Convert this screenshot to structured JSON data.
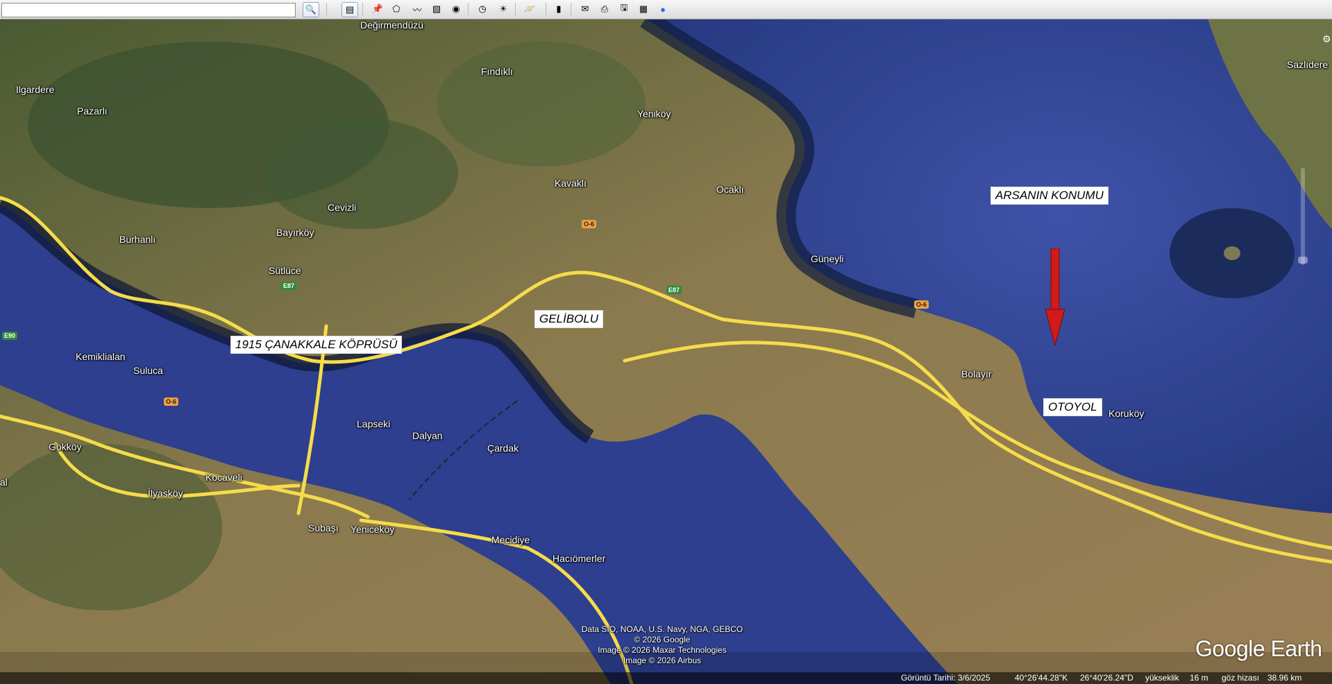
{
  "toolbar": {
    "search_value": "",
    "buttons": [
      {
        "name": "search-button",
        "icon": "magnifier-icon",
        "glyph": "🔍"
      },
      {
        "name": "sidebar-toggle-button",
        "icon": "sidebar-icon",
        "glyph": "▤"
      },
      {
        "name": "add-placemark-button",
        "icon": "pushpin-icon",
        "glyph": "📌"
      },
      {
        "name": "add-polygon-button",
        "icon": "polygon-icon",
        "glyph": "⬠"
      },
      {
        "name": "add-path-button",
        "icon": "path-icon",
        "glyph": "〰"
      },
      {
        "name": "image-overlay-button",
        "icon": "overlay-icon",
        "glyph": "▧"
      },
      {
        "name": "record-tour-button",
        "icon": "tour-icon",
        "glyph": "◉"
      },
      {
        "name": "historical-imagery-button",
        "icon": "clock-icon",
        "glyph": "◷"
      },
      {
        "name": "sunlight-button",
        "icon": "sun-icon",
        "glyph": "☀"
      },
      {
        "name": "planets-button",
        "icon": "planet-icon",
        "glyph": "🪐"
      },
      {
        "name": "ruler-button",
        "icon": "ruler-icon",
        "glyph": "▮"
      },
      {
        "name": "email-button",
        "icon": "envelope-icon",
        "glyph": "✉"
      },
      {
        "name": "print-button",
        "icon": "printer-icon",
        "glyph": "⎙"
      },
      {
        "name": "save-image-button",
        "icon": "save-image-icon",
        "glyph": "🖫"
      },
      {
        "name": "view-in-maps-button",
        "icon": "map-icon",
        "glyph": "▦"
      },
      {
        "name": "earth-gallery-button",
        "icon": "globe-icon",
        "glyph": "●"
      }
    ]
  },
  "map": {
    "places": [
      {
        "name": "Değirmendüzü"
      },
      {
        "name": "Fındıklı"
      },
      {
        "name": "Ilgardere"
      },
      {
        "name": "Pazarlı"
      },
      {
        "name": "Yeniköy"
      },
      {
        "name": "Sazlıdere"
      },
      {
        "name": "Kavaklı"
      },
      {
        "name": "Ocaklı"
      },
      {
        "name": "Cevizli"
      },
      {
        "name": "Bayırköy"
      },
      {
        "name": "Burhanlı"
      },
      {
        "name": "Sütlüce"
      },
      {
        "name": "Güneyli"
      },
      {
        "name": "Kemiklialan"
      },
      {
        "name": "Suluca"
      },
      {
        "name": "Bolayır"
      },
      {
        "name": "Koruköy"
      },
      {
        "name": "Gökköy"
      },
      {
        "name": "Lapseki"
      },
      {
        "name": "Dalyan"
      },
      {
        "name": "Çardak"
      },
      {
        "name": "Kocaveli"
      },
      {
        "name": "İlyasköy"
      },
      {
        "name": "Subaşı"
      },
      {
        "name": "Yeniceköy"
      },
      {
        "name": "Mecidiye"
      },
      {
        "name": "Hacıömerler"
      },
      {
        "name": "al"
      }
    ],
    "annotations": {
      "plot_location": "ARSANIN KONUMU",
      "gelibolu": "GELİBOLU",
      "bridge": "1915 ÇANAKKALE KÖPRÜSÜ",
      "highway": "OTOYOL"
    },
    "road_shields": {
      "o6": "O-6",
      "e87": "E87",
      "e90": "E90"
    },
    "credits": [
      "Data SIO, NOAA, U.S. Navy, NGA, GEBCO",
      "© 2026 Google",
      "Image © 2026 Maxar Technologies",
      "Image © 2026 Airbus"
    ],
    "logo": "Google Earth",
    "colors": {
      "sea": "#2a3f8c",
      "land": "#8a7a4e",
      "road": "#f5dc4a",
      "arrow": "#d11a1a"
    }
  },
  "statusbar": {
    "imagery_date": "Görüntü Tarihi: 3/6/2025",
    "latitude": "40°26'44.28\"K",
    "longitude": "26°40'26.24\"D",
    "elevation_label": "yükseklik",
    "elevation_value": "16 m",
    "eye_alt_label": "göz hizası",
    "eye_alt_value": "38.96 km"
  }
}
